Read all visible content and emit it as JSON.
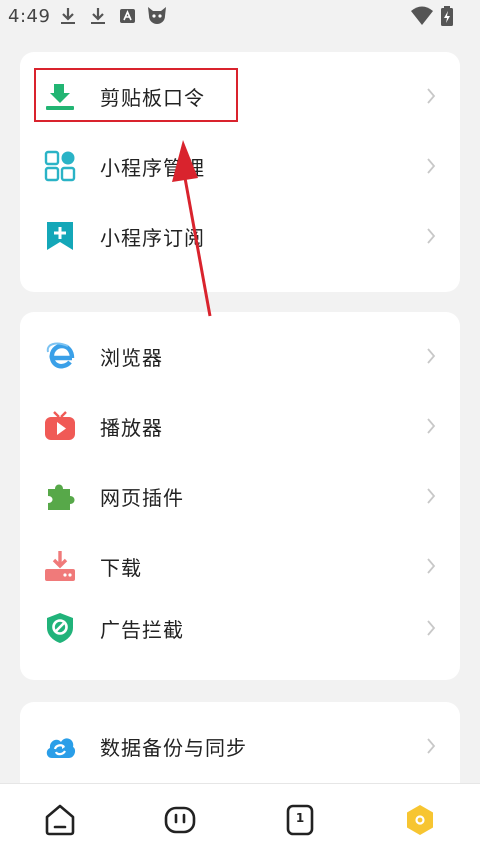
{
  "status_bar": {
    "time": "4:49",
    "left_icons": [
      "download-icon",
      "download-icon",
      "font-app-icon",
      "cat-mascot-icon"
    ],
    "right_icons": [
      "wifi-icon",
      "battery-icon"
    ]
  },
  "sections": [
    {
      "items": [
        {
          "label": "剪贴板口令",
          "icon": "clipboard-download-icon",
          "color": "#22b573"
        },
        {
          "label": "小程序管理",
          "icon": "mini-program-grid-icon",
          "color": "#2ab3c6"
        },
        {
          "label": "小程序订阅",
          "icon": "bookmark-add-icon",
          "color": "#14a7b8"
        }
      ]
    },
    {
      "items": [
        {
          "label": "浏览器",
          "icon": "browser-e-icon",
          "color": "#3aa0e8"
        },
        {
          "label": "播放器",
          "icon": "tv-player-icon",
          "color": "#f05a56"
        },
        {
          "label": "网页插件",
          "icon": "puzzle-icon",
          "color": "#57a849"
        },
        {
          "label": "下载",
          "icon": "download-tray-icon",
          "color": "#f07a7a"
        },
        {
          "label": "广告拦截",
          "icon": "shield-block-icon",
          "color": "#21b37a"
        }
      ]
    },
    {
      "items": [
        {
          "label": "数据备份与同步",
          "icon": "cloud-sync-icon",
          "color": "#2a9ee8"
        }
      ]
    }
  ],
  "annotation": {
    "color": "#d9232d"
  },
  "bottom_nav": {
    "tab_count": "1",
    "items": [
      "home-icon",
      "robot-face-icon",
      "tabs-icon",
      "profile-hexagon-icon"
    ]
  }
}
